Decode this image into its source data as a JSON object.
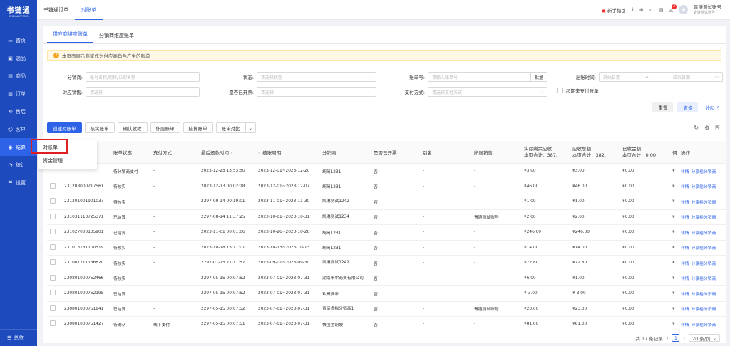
{
  "sidebar": {
    "logo": "书链通",
    "logo_sub": "ZHILIANTONG",
    "items": [
      {
        "label": "首页",
        "icon": "monitor-icon"
      },
      {
        "label": "选品",
        "icon": "shelf-icon"
      },
      {
        "label": "商品",
        "icon": "goods-icon"
      },
      {
        "label": "订单",
        "icon": "order-icon"
      },
      {
        "label": "售后",
        "icon": "aftersale-icon"
      },
      {
        "label": "客户",
        "icon": "customer-icon"
      },
      {
        "label": "结算",
        "icon": "settle-icon"
      },
      {
        "label": "统计",
        "icon": "stats-icon"
      },
      {
        "label": "设置",
        "icon": "settings-icon"
      }
    ],
    "bottom": "总览"
  },
  "topbar": {
    "tabs": [
      "书链通订单",
      "对账单"
    ],
    "guide": "新手指引",
    "badge": "2",
    "user_name": "青链测试账号",
    "user_sub": "青链测试账号"
  },
  "subtabs": [
    "供应商维度账单",
    "分销商维度账单"
  ],
  "notice": "本页面展示商家作为供应商角色产生的账单",
  "filters": {
    "distributor_label": "分销商:",
    "distributor_ph": "账号名称/昵称/公司名称",
    "status_label": "状态:",
    "status_ph": "请选择状态",
    "bill_no_label": "账单号:",
    "bill_no_ph": "请输入账单号",
    "batch": "批量",
    "out_time_label": "出账时间:",
    "start_ph": "开始日期",
    "end_ph": "结束日期",
    "sales_label": "对应销售:",
    "sales_ph": "请选择",
    "invoiced_label": "是否已开票:",
    "invoiced_ph": "请选择",
    "pay_label": "支付方式:",
    "pay_ph": "请选择支付方式",
    "overdue": "超期未支付账单",
    "reset": "重置",
    "query": "查询",
    "collapse": "收起"
  },
  "actions": [
    "创建对账单",
    "核实账单",
    "确认收款",
    "作废账单",
    "结算账单",
    "账单对比"
  ],
  "popup": [
    "对账单",
    "资金管理"
  ],
  "table": {
    "headers": [
      "账单状态",
      "支付方式",
      "最后还款时间",
      "结账周期",
      "分销商",
      "是否已开票",
      "别名",
      "所属销售",
      "操作"
    ],
    "header_dual": [
      {
        "top": "实际剩余应收",
        "bottom": "本页合计：387."
      },
      {
        "top": "应收总额",
        "bottom": "本页合计：382."
      },
      {
        "top": "已收金额",
        "bottom": "本页合计：0.00"
      }
    ],
    "header_cut": "调",
    "rows": [
      {
        "no": "",
        "status": "待分销商支付",
        "pay": "-",
        "due": "2023-12-25 13:53:50",
        "period": "2023-12-01~2023-12-20",
        "dist": "胡简1231",
        "inv": "否",
        "alias": "-",
        "sales": "-",
        "remain": "¥3.00",
        "total": "¥3.00",
        "paid": "¥0.00",
        "cut": "¥",
        "op1": "详情",
        "op2": "分享给分销商"
      },
      {
        "no": "231208000217561",
        "status": "待核实",
        "pay": "-",
        "due": "2023-12-13 00:02:18",
        "period": "2023-12-01~2023-12-07",
        "dist": "胡简1231",
        "inv": "否",
        "alias": "-",
        "sales": "-",
        "remain": "¥46.00",
        "total": "¥46.00",
        "paid": "¥0.00",
        "cut": "¥",
        "op1": "详情",
        "op2": "分享给分销商"
      },
      {
        "no": "231201001901037",
        "status": "待核实",
        "pay": "-",
        "due": "2297-09-14 00:19:01",
        "period": "2023-11-01~2023-11-30",
        "dist": "凯琳测试1242",
        "inv": "否",
        "alias": "-",
        "sales": "-",
        "remain": "¥1.00",
        "total": "¥1.00",
        "paid": "¥0.00",
        "cut": "¥",
        "op1": "详情",
        "op2": "分享给分销商"
      },
      {
        "no": "231031113725371",
        "status": "已结算",
        "pay": "-",
        "due": "2297-08-14 11:37:25",
        "period": "2023-10-01~2023-10-31",
        "dist": "凯琳测试1234",
        "inv": "否",
        "alias": "-",
        "sales": "青链测试账号",
        "remain": "¥2.00",
        "total": "¥2.00",
        "paid": "¥0.00",
        "cut": "¥",
        "op1": "详情",
        "op2": "分享给分销商"
      },
      {
        "no": "231027000105901",
        "status": "已结算",
        "pay": "-",
        "due": "2023-11-01 00:01:06",
        "period": "2023-10-26~2023-10-26",
        "dist": "胡简1231",
        "inv": "否",
        "alias": "-",
        "sales": "-",
        "remain": "¥246.00",
        "total": "¥246.00",
        "paid": "¥0.00",
        "cut": "¥",
        "op1": "详情",
        "op2": "分享给分销商"
      },
      {
        "no": "231013151100519",
        "status": "待核实",
        "pay": "-",
        "due": "2023-10-18 15:11:01",
        "period": "2023-10-13~2023-10-13",
        "dist": "胡简1231",
        "inv": "否",
        "alias": "-",
        "sales": "-",
        "remain": "¥14.00",
        "total": "¥14.00",
        "paid": "¥0.00",
        "cut": "¥",
        "op1": "详情",
        "op2": "分享给分销商"
      },
      {
        "no": "231001211156620",
        "status": "待核实",
        "pay": "-",
        "due": "2297-07-15 21:11:57",
        "period": "2023-09-01~2023-09-30",
        "dist": "凯琳测试1242",
        "inv": "否",
        "alias": "-",
        "sales": "-",
        "remain": "¥72.80",
        "total": "¥72.80",
        "paid": "¥0.00",
        "cut": "¥",
        "op1": "详情",
        "op2": "分享给分销商"
      },
      {
        "no": "230801000752466",
        "status": "待核实",
        "pay": "-",
        "due": "2297-05-15 00:07:52",
        "period": "2023-07-01~2023-07-31",
        "dist": "湖南米尔商贸有限公司",
        "inv": "否",
        "alias": "-",
        "sales": "-",
        "remain": "¥6.00",
        "total": "¥1.00",
        "paid": "¥0.00",
        "cut": "¥",
        "op1": "详情",
        "op2": "分享给分销商"
      },
      {
        "no": "230801000752195",
        "status": "已结算",
        "pay": "-",
        "due": "2297-05-15 00:07:52",
        "period": "2023-07-01~2023-07-31",
        "dist": "欢哥演示",
        "inv": "否",
        "alias": "-",
        "sales": "-",
        "remain": "¥-3.00",
        "total": "¥-3.00",
        "paid": "¥0.00",
        "cut": "¥",
        "op1": "详情",
        "op2": "分享给分销商"
      },
      {
        "no": "230801000751841",
        "status": "已结算",
        "pay": "-",
        "due": "2297-05-15 00:07:52",
        "period": "2023-07-01~2023-07-31",
        "dist": "青链虚拟分销商1",
        "inv": "否",
        "alias": "-",
        "sales": "青链测试账号",
        "remain": "¥23.00",
        "total": "¥23.00",
        "paid": "¥0.00",
        "cut": "¥",
        "op1": "详情",
        "op2": "分享给分销商"
      },
      {
        "no": "230801000751427",
        "status": "待确认",
        "pay": "线下支付",
        "due": "2297-05-15 00:07:51",
        "period": "2023-07-01~2023-07-31",
        "dist": "快团团胡嫂",
        "inv": "否",
        "alias": "-",
        "sales": "-",
        "remain": "¥81.00",
        "total": "¥81.00",
        "paid": "¥0.00",
        "cut": "¥",
        "op1": "详情",
        "op2": "分享给分销商"
      }
    ]
  },
  "pager": {
    "total": "共 17 条记录",
    "page": "1",
    "size": "20 条/页"
  }
}
